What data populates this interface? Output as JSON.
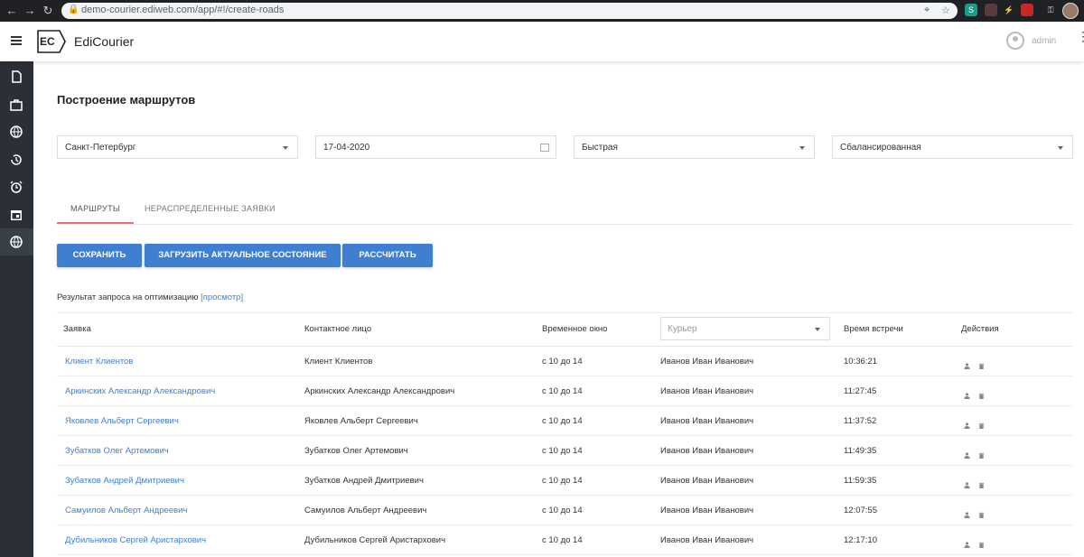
{
  "browser": {
    "url": "demo-courier.ediweb.com/app/#!/create-roads"
  },
  "header": {
    "brand": "EdiCourier",
    "logo_text": "EC",
    "user": "admin"
  },
  "sidebar": {
    "items": [
      {
        "icon": "document-icon"
      },
      {
        "icon": "briefcase-icon"
      },
      {
        "icon": "globe-icon"
      },
      {
        "icon": "history-icon"
      },
      {
        "icon": "alarm-icon"
      },
      {
        "icon": "calendar-icon"
      },
      {
        "icon": "globe-icon",
        "active": true
      }
    ]
  },
  "page": {
    "title": "Построение маршрутов"
  },
  "filters": {
    "city": "Санкт-Петербург",
    "date": "17-04-2020",
    "speed": "Быстрая",
    "balance": "Сбалансированная"
  },
  "tabs": [
    {
      "label": "МАРШРУТЫ",
      "active": true
    },
    {
      "label": "НЕРАСПРЕДЕЛЕННЫЕ ЗАЯВКИ",
      "active": false
    }
  ],
  "buttons": {
    "save": "СОХРАНИТЬ",
    "load": "ЗАГРУЗИТЬ АКТУАЛЬНОЕ СОСТОЯНИЕ",
    "calc": "РАССЧИТАТЬ"
  },
  "result": {
    "text": "Результат запроса на оптимизацию",
    "link": "[просмотр]"
  },
  "table": {
    "headers": {
      "order": "Заявка",
      "contact": "Контактное лицо",
      "window": "Временное окно",
      "courier_placeholder": "Курьер",
      "meet_time": "Время встречи",
      "actions": "Действия"
    },
    "rows": [
      {
        "order": "Клиент Клиентов",
        "contact": "Клиент Клиентов",
        "window": "с 10 до 14",
        "courier": "Иванов Иван Иванович",
        "time": "10:36:21"
      },
      {
        "order": "Аркинских Александр Александрович",
        "contact": "Аркинских Александр Александрович",
        "window": "с 10 до 14",
        "courier": "Иванов Иван Иванович",
        "time": "11:27:45"
      },
      {
        "order": "Яковлев Альберт Сергеевич",
        "contact": "Яковлев Альберт Сергеевич",
        "window": "с 10 до 14",
        "courier": "Иванов Иван Иванович",
        "time": "11:37:52"
      },
      {
        "order": "Зубатков Олег Артемович",
        "contact": "Зубатков Олег Артемович",
        "window": "с 10 до 14",
        "courier": "Иванов Иван Иванович",
        "time": "11:49:35"
      },
      {
        "order": "Зубатков Андрей Дмитриевич",
        "contact": "Зубатков Андрей Дмитриевич",
        "window": "с 10 до 14",
        "courier": "Иванов Иван Иванович",
        "time": "11:59:35"
      },
      {
        "order": "Самуилов Альберт Андреевич",
        "contact": "Самуилов Альберт Андреевич",
        "window": "с 10 до 14",
        "courier": "Иванов Иван Иванович",
        "time": "12:07:55"
      },
      {
        "order": "Дубильников Сергей Аристархович",
        "contact": "Дубильников Сергей Аристархович",
        "window": "с 10 до 14",
        "courier": "Иванов Иван Иванович",
        "time": "12:17:10"
      }
    ]
  },
  "colors": {
    "accent": "#3f7fd1",
    "tab_underline": "#e57373",
    "sidebar": "#2b3036"
  }
}
